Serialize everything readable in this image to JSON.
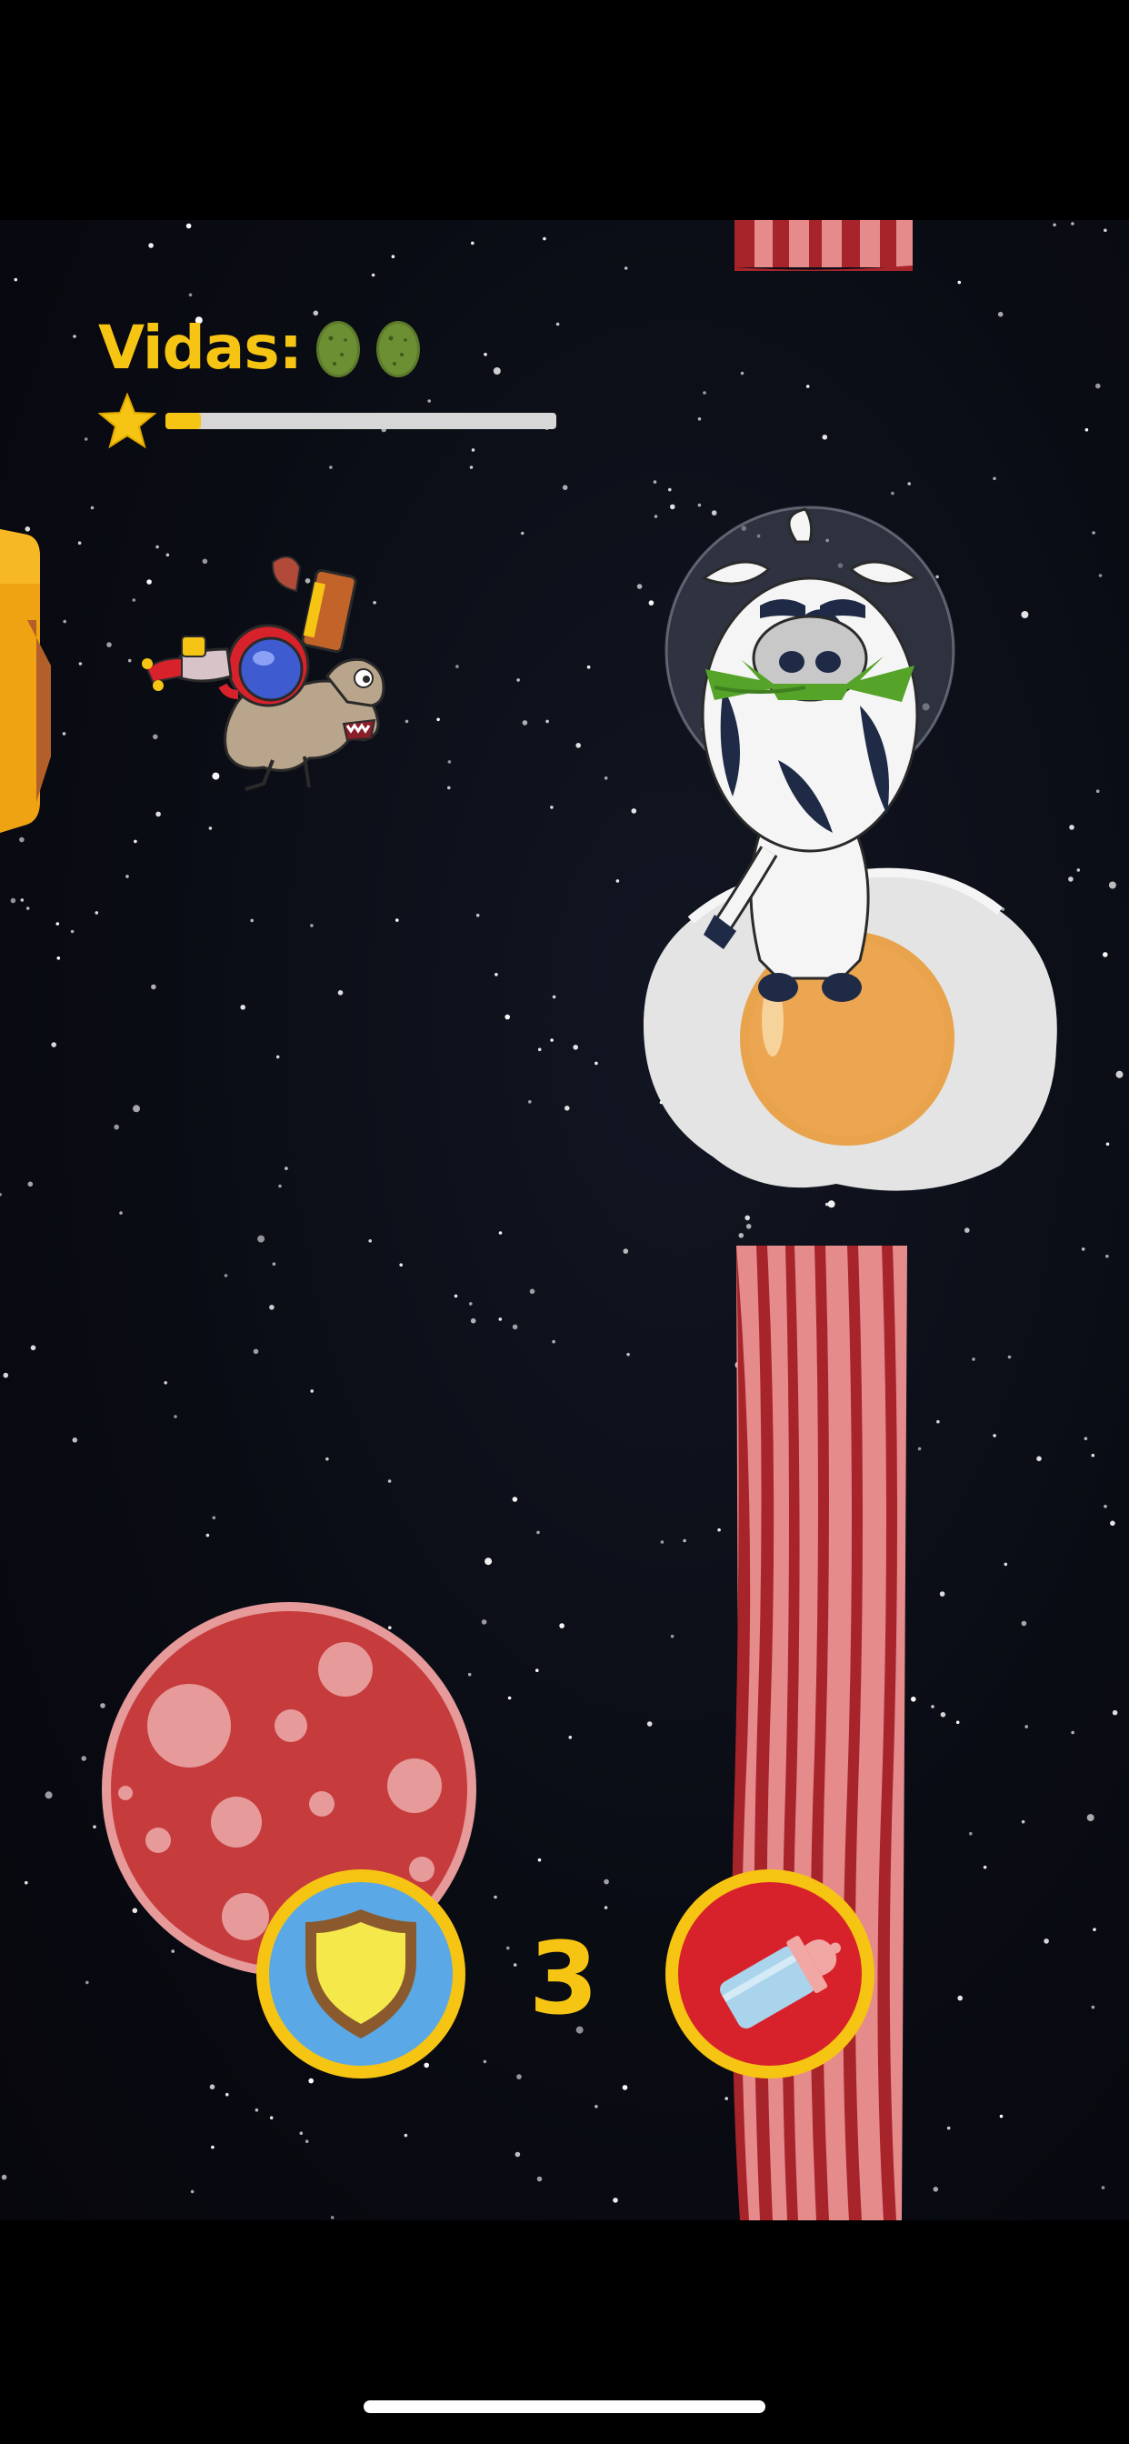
{
  "hud": {
    "lives_label": "Vidas:",
    "lives_count": 2,
    "star_progress": 0.09
  },
  "controls": {
    "shield_counter": "3"
  },
  "icons": {
    "life": "green-egg-icon",
    "progress": "star-icon",
    "shield": "shield-icon",
    "bottle": "baby-bottle-icon"
  },
  "colors": {
    "accent_yellow": "#f6c413",
    "bacon_dark": "#a7242a",
    "bacon_light": "#e58b8c",
    "salami": "#c63b3b",
    "egg_white": "#e6e6e6",
    "egg_yolk": "#e8a34c",
    "shield_button_bg": "#5aa8e6",
    "bottle_button_bg": "#d8222b"
  }
}
